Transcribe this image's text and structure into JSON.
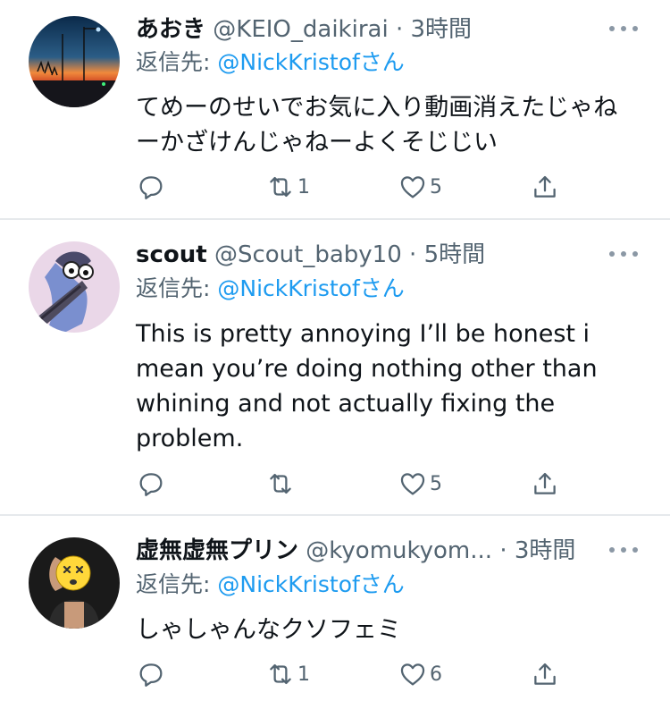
{
  "tweets": [
    {
      "name": "あおき",
      "handle": "@KEIO_daikirai",
      "time": "3時間",
      "reply_label": "返信先:",
      "reply_handle": "@NickKristofさん",
      "text": "てめーのせいでお気に入り動画消えたじゃねーかざけんじゃねーよくそじじい",
      "retweets": "1",
      "likes": "5",
      "avatar": "sunset-street-photo"
    },
    {
      "name": "scout",
      "handle": "@Scout_baby10",
      "time": "5時間",
      "reply_label": "返信先:",
      "reply_handle": "@NickKristofさん",
      "text": "This is pretty annoying I’ll be honest i mean you’re doing nothing other than whining and not actually fixing the problem.",
      "retweets": "",
      "likes": "5",
      "avatar": "cartoon-bird"
    },
    {
      "name": "虚無虚無プリン",
      "handle": "@kyomukyom...",
      "time": "3時間",
      "reply_label": "返信先:",
      "reply_handle": "@NickKristofさん",
      "text": "しゃしゃんなクソフェミ",
      "retweets": "1",
      "likes": "6",
      "avatar": "person-with-emoji-face"
    }
  ],
  "icons": {
    "reply": "reply-icon",
    "retweet": "retweet-icon",
    "like": "like-icon",
    "share": "share-icon",
    "more": "more-icon"
  },
  "colors": {
    "link": "#1d9bf0",
    "secondary": "#536471",
    "text": "#0f1419",
    "divider": "#e6e9ec"
  }
}
